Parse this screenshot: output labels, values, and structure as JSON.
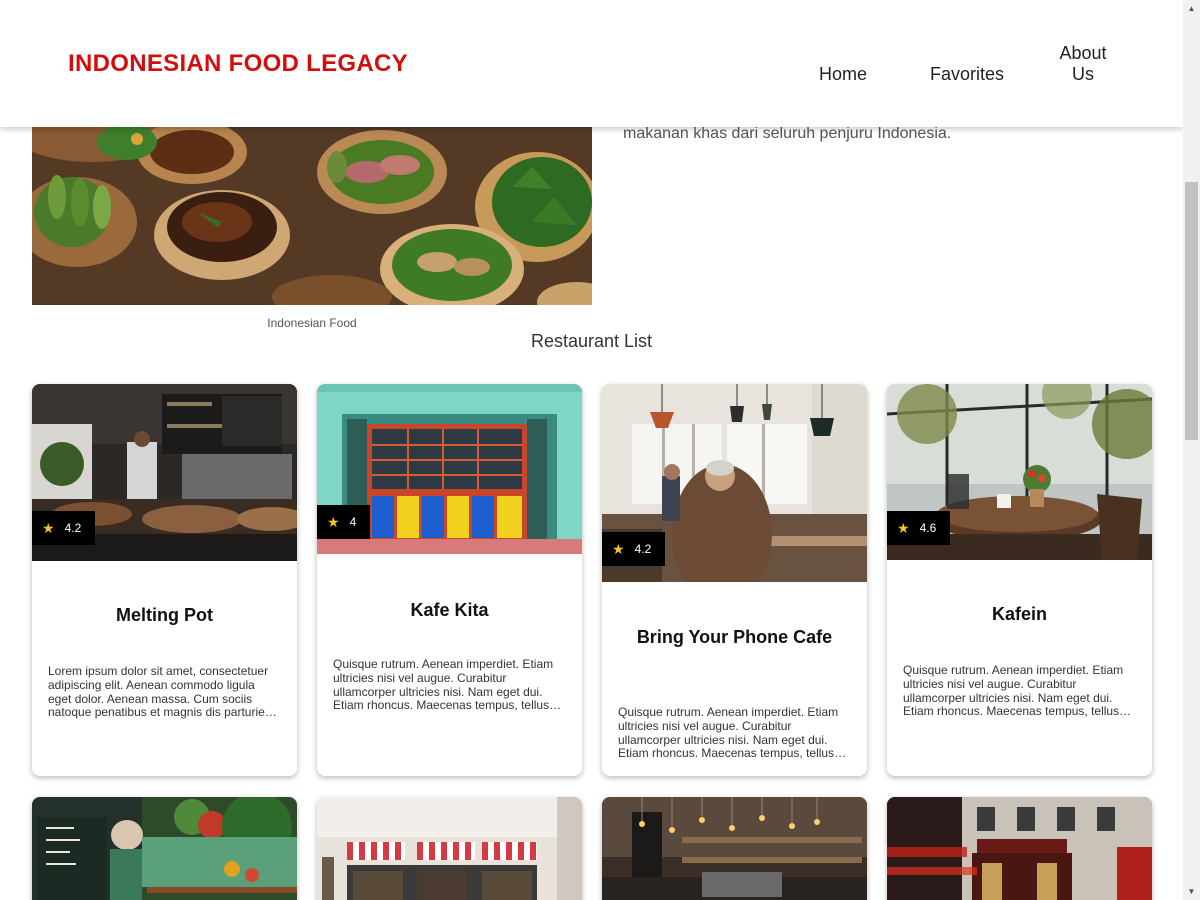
{
  "header": {
    "brand": "INDONESIAN FOOD LEGACY",
    "nav": {
      "home": "Home",
      "favorites": "Favorites",
      "about": "About Us"
    }
  },
  "hero": {
    "caption": "Indonesian Food",
    "text": "makanan khas dari seluruh penjuru Indonesia."
  },
  "section_title": "Restaurant List",
  "restaurants": [
    {
      "name": "Melting Pot",
      "rating": "4.2",
      "description": "Lorem ipsum dolor sit amet, consectetuer adipiscing elit. Aenean commodo ligula eget dolor. Aenean massa. Cum sociis natoque penatibus et magnis dis parturient montes."
    },
    {
      "name": "Kafe Kita",
      "rating": "4",
      "description": "Quisque rutrum. Aenean imperdiet. Etiam ultricies nisi vel augue. Curabitur ullamcorper ultricies nisi. Nam eget dui. Etiam rhoncus. Maecenas tempus, tellus eget condimentum."
    },
    {
      "name": "Bring Your Phone Cafe",
      "rating": "4.2",
      "description": "Quisque rutrum. Aenean imperdiet. Etiam ultricies nisi vel augue. Curabitur ullamcorper ultricies nisi. Nam eget dui. Etiam rhoncus. Maecenas tempus, tellus eget condimentum."
    },
    {
      "name": "Kafein",
      "rating": "4.6",
      "description": "Quisque rutrum. Aenean imperdiet. Etiam ultricies nisi vel augue. Curabitur ullamcorper ultricies nisi. Nam eget dui. Etiam rhoncus. Maecenas tempus, tellus eget condimentum."
    }
  ],
  "colors": {
    "brand": "#d10f0f",
    "star": "#f5c518",
    "rating_badge": "#000000"
  },
  "icons": {
    "rating": "star-icon"
  }
}
